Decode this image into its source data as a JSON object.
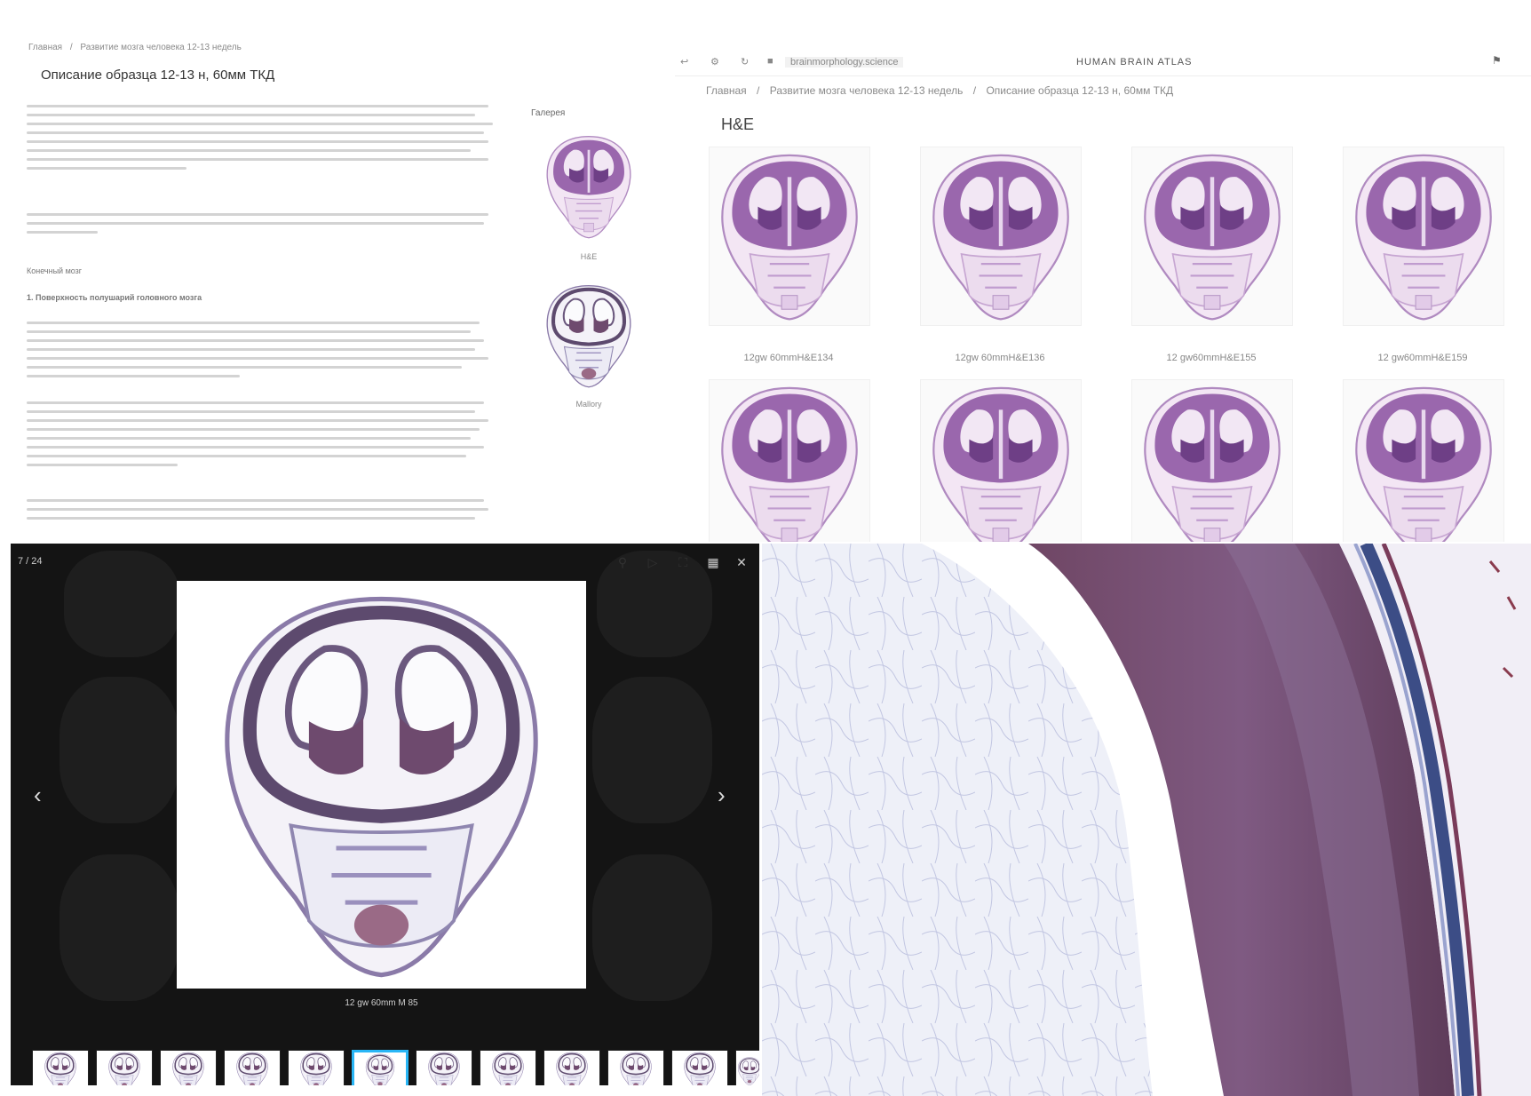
{
  "description_page": {
    "breadcrumb": [
      "Главная",
      "Развитие мозга человека 12-13 недель"
    ],
    "title": "Описание образца 12-13 н, 60мм ТКД",
    "section_heading": "Конечный мозг",
    "subsection_heading": "1. Поверхность полушарий головного мозга",
    "gallery_label": "Галерея",
    "thumbnails": [
      {
        "caption": "H&E"
      },
      {
        "caption": "Mallory"
      }
    ]
  },
  "he_gallery": {
    "url": "brainmorphology.science",
    "site_title": "HUMAN BRAIN ATLAS",
    "breadcrumb": [
      "Главная",
      "Развитие мозга человека 12-13 недель",
      "Описание образца 12-13 н, 60мм ТКД"
    ],
    "section_title": "H&E",
    "row1_captions": [
      "12gw 60mmH&E134",
      "12gw 60mmH&E136",
      "12 gw60mmH&E155",
      "12 gw60mmH&E159"
    ]
  },
  "lightbox": {
    "counter": "7 / 24",
    "caption": "12 gw 60mm M 85",
    "icons": [
      "zoom-icon",
      "play-icon",
      "fullscreen-icon",
      "grid-icon",
      "close-icon"
    ],
    "active_thumb_index": 5,
    "thumb_count": 12
  },
  "colors": {
    "he_stain": "#8b5a9e",
    "he_light": "#d9c2e0",
    "mallory_purple": "#6e4a6e",
    "lightbox_bg": "#141414",
    "active_border": "#29b6f6"
  }
}
